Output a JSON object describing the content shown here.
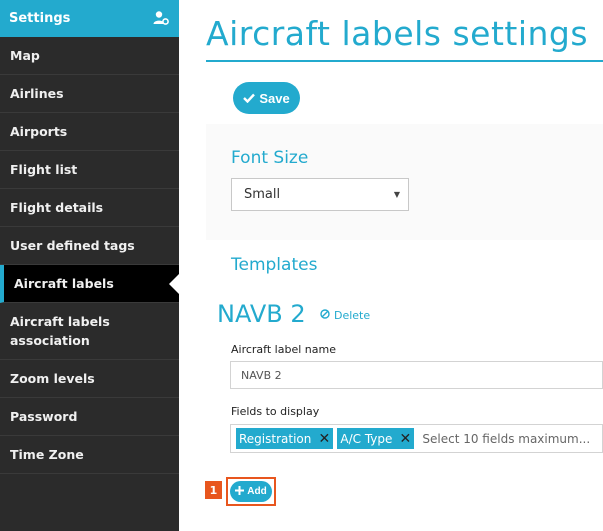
{
  "sidebar": {
    "header": {
      "title": "Settings"
    },
    "items": [
      {
        "label": "Map"
      },
      {
        "label": "Airlines"
      },
      {
        "label": "Airports"
      },
      {
        "label": "Flight list"
      },
      {
        "label": "Flight details"
      },
      {
        "label": "User defined tags"
      },
      {
        "label": "Aircraft labels",
        "active": true
      },
      {
        "label": "Aircraft labels association"
      },
      {
        "label": "Zoom levels"
      },
      {
        "label": "Password"
      },
      {
        "label": "Time Zone"
      }
    ]
  },
  "main": {
    "title": "Aircraft labels settings",
    "save_label": "Save",
    "font_size": {
      "title": "Font Size",
      "selected": "Small"
    },
    "templates": {
      "title": "Templates",
      "template_name": "NAVB 2",
      "delete_label": "Delete",
      "name_field_label": "Aircraft label name",
      "name_value": "NAVB 2",
      "fields_label": "Fields to display",
      "tags": [
        "Registration",
        "A/C Type"
      ],
      "fields_placeholder": "Select 10 fields maximum...",
      "add_label": "Add",
      "step_number": "1"
    }
  },
  "colors": {
    "accent": "#23aace",
    "sidebar_bg": "#2b2b2b",
    "highlight": "#e8561e"
  }
}
